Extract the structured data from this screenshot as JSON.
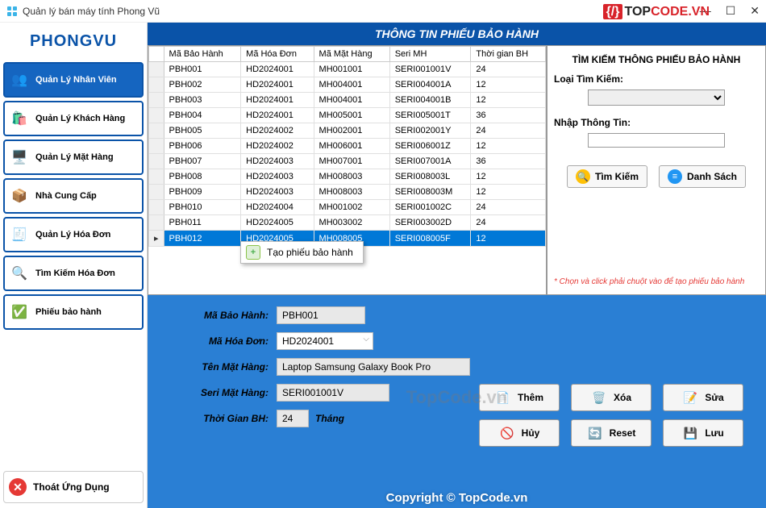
{
  "window": {
    "title": "Quản lý bán máy tính Phong Vũ"
  },
  "brand": {
    "logo": "PHONGVU",
    "topcode_bracket": "{/}",
    "topcode_1": "TOP",
    "topcode_2": "CODE.VN",
    "watermark_center": "TopCode.vn",
    "copyright": "Copyright © TopCode.vn"
  },
  "sidebar": {
    "items": [
      {
        "label": "Quản Lý Nhân Viên",
        "active": true
      },
      {
        "label": "Quản Lý Khách Hàng",
        "active": false
      },
      {
        "label": "Quản Lý Mặt Hàng",
        "active": false
      },
      {
        "label": "Nhà Cung Cấp",
        "active": false
      },
      {
        "label": "Quản Lý Hóa Đơn",
        "active": false
      },
      {
        "label": "Tìm Kiếm Hóa Đơn",
        "active": false
      },
      {
        "label": "Phiếu bảo hành",
        "active": false
      }
    ],
    "exit_label": "Thoát Ứng Dụng"
  },
  "header": {
    "title": "THÔNG TIN PHIẾU BẢO HÀNH"
  },
  "table": {
    "columns": [
      "Mã Bảo Hành",
      "Mã Hóa Đơn",
      "Mã Mặt Hàng",
      "Seri MH",
      "Thời gian BH"
    ],
    "rows": [
      [
        "PBH001",
        "HD2024001",
        "MH001001",
        "SERI001001V",
        "24"
      ],
      [
        "PBH002",
        "HD2024001",
        "MH004001",
        "SERI004001A",
        "12"
      ],
      [
        "PBH003",
        "HD2024001",
        "MH004001",
        "SERI004001B",
        "12"
      ],
      [
        "PBH004",
        "HD2024001",
        "MH005001",
        "SERI005001T",
        "36"
      ],
      [
        "PBH005",
        "HD2024002",
        "MH002001",
        "SERI002001Y",
        "24"
      ],
      [
        "PBH006",
        "HD2024002",
        "MH006001",
        "SERI006001Z",
        "12"
      ],
      [
        "PBH007",
        "HD2024003",
        "MH007001",
        "SERI007001A",
        "36"
      ],
      [
        "PBH008",
        "HD2024003",
        "MH008003",
        "SERI008003L",
        "12"
      ],
      [
        "PBH009",
        "HD2024003",
        "MH008003",
        "SERI008003M",
        "12"
      ],
      [
        "PBH010",
        "HD2024004",
        "MH001002",
        "SERI001002C",
        "24"
      ],
      [
        "PBH011",
        "HD2024005",
        "MH003002",
        "SERI003002D",
        "24"
      ],
      [
        "PBH012",
        "HD2024005",
        "MH008005",
        "SERI008005F",
        "12"
      ]
    ],
    "selected_index": 11,
    "context_menu": "Tạo phiếu bảo hành"
  },
  "search": {
    "title": "TÌM KIẾM THÔNG PHIẾU BẢO HÀNH",
    "type_label": "Loại Tìm Kiếm:",
    "type_value": "",
    "input_label": "Nhập Thông Tin:",
    "input_value": "",
    "btn_search": "Tìm Kiếm",
    "btn_list": "Danh Sách",
    "hint": "* Chọn và click phải chuột vào để tạo phiếu bảo hành"
  },
  "form": {
    "labels": {
      "code": "Mã Bảo Hành:",
      "invoice": "Mã Hóa Đơn:",
      "product": "Tên Mặt Hàng:",
      "serial": "Seri Mặt Hàng:",
      "duration": "Thời Gian BH:",
      "unit": "Tháng"
    },
    "values": {
      "code": "PBH001",
      "invoice": "HD2024001",
      "product": "Laptop Samsung Galaxy Book Pro",
      "serial": "SERI001001V",
      "duration": "24"
    },
    "actions": {
      "add": "Thêm",
      "delete": "Xóa",
      "edit": "Sửa",
      "cancel": "Hủy",
      "reset": "Reset",
      "save": "Lưu"
    }
  }
}
